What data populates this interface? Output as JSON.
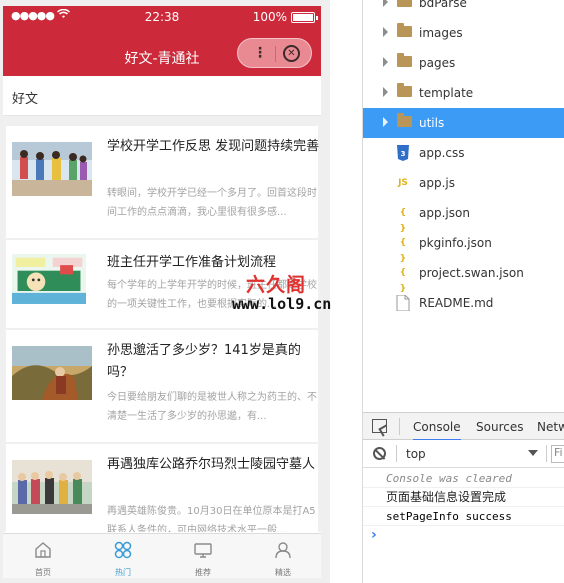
{
  "status_bar": {
    "signal": "●●●●●",
    "time": "22:38",
    "battery": "100%"
  },
  "nav": {
    "title": "好文-青通社",
    "menu_glyph": "⋮",
    "close_glyph": "✕"
  },
  "section": {
    "title": "好文"
  },
  "articles": [
    {
      "title": "学校开学工作反思 发现问题持续完善",
      "desc": "转眼间，学校开学已经一个多月了。回首这段时间工作的点点滴滴，我心里很有很多感..."
    },
    {
      "title": "班主任开学工作准备计划流程",
      "desc": "每个学年的上学年开学的时候，班主任都是学校的一项关键性工作，也要根据实际的..."
    },
    {
      "title": "孙思邈活了多少岁？141岁是真的吗？",
      "desc": "今日要给朋友们聊的是被世人称之为药王的、不清楚一生活了多少岁的孙思邈，有..."
    },
    {
      "title": "再遇独库公路乔尔玛烈士陵园守墓人",
      "desc": "再遇英雄陈俊贵。10月30日在单位原本是打A5联系人条件的，可由网络技术水平一般..."
    }
  ],
  "tabs": [
    {
      "label": "首页",
      "icon": "home-icon",
      "active": false
    },
    {
      "label": "热门",
      "icon": "hot-icon",
      "active": true
    },
    {
      "label": "推荐",
      "icon": "recommend-icon",
      "active": false
    },
    {
      "label": "精选",
      "icon": "featured-icon",
      "active": false
    }
  ],
  "watermark": {
    "brand": "六久阁",
    "url": "www.lol9.cn"
  },
  "file_tree": [
    {
      "label": "bdParse",
      "type": "folder",
      "selected": false
    },
    {
      "label": "images",
      "type": "folder",
      "selected": false
    },
    {
      "label": "pages",
      "type": "folder",
      "selected": false
    },
    {
      "label": "template",
      "type": "folder",
      "selected": false
    },
    {
      "label": "utils",
      "type": "folder",
      "selected": true
    },
    {
      "label": "app.css",
      "type": "css",
      "selected": false
    },
    {
      "label": "app.js",
      "type": "js",
      "selected": false
    },
    {
      "label": "app.json",
      "type": "json",
      "selected": false
    },
    {
      "label": "pkginfo.json",
      "type": "json",
      "selected": false
    },
    {
      "label": "project.swan.json",
      "type": "json",
      "selected": false
    },
    {
      "label": "README.md",
      "type": "md",
      "selected": false
    }
  ],
  "devtools": {
    "tabs": [
      "Console",
      "Sources",
      "Netw"
    ],
    "active_tab": "Console",
    "context": "top",
    "filter_placeholder": "Fi"
  },
  "console_logs": [
    {
      "text": "Console was cleared",
      "kind": "cleared"
    },
    {
      "text": "页面基础信息设置完成",
      "kind": "text"
    },
    {
      "text": "setPageInfo success",
      "kind": "code"
    }
  ],
  "colors": {
    "brand_red": "#cc2a3a",
    "selected_blue": "#3c9bf5",
    "tab_active": "#3a9bd5"
  }
}
